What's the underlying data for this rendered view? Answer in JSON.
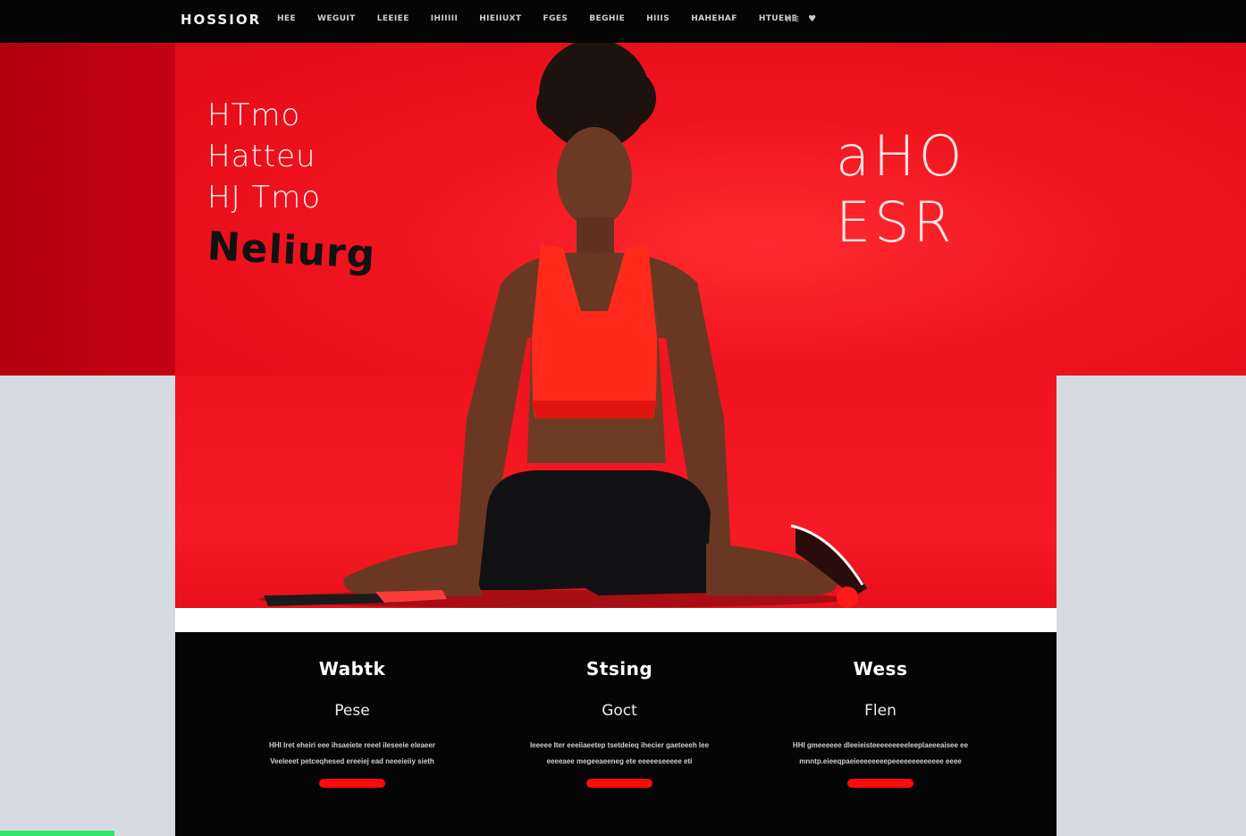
{
  "header": {
    "brand": "HOSSIOR",
    "nav_items": [
      "HEE",
      "WEGUIT",
      "LEEIEE",
      "IHIIIII",
      "HIEIIUXT",
      "FGES",
      "BEGHIE",
      "HIIIS",
      "HAHEHAF",
      "HTUEHE"
    ],
    "extra_label": "HIE",
    "icon": "heart-icon"
  },
  "hero": {
    "lines": [
      "HTmo",
      "Hatteu",
      "HJ Tmo"
    ],
    "accent": "Neliurg",
    "right_lines": [
      "aHO",
      "ESR"
    ],
    "background_color": "#f0141f"
  },
  "features": [
    {
      "title": "Wabtk",
      "subtitle": "Pese",
      "text": "HHI Iret eheiri eee ihsaeiete reeel ileseeie eleaeer Veeleeet petceqhesed ereeiej ead neeeieiiy sieth",
      "button_color": "#ff0a0a"
    },
    {
      "title": "Stsing",
      "subtitle": "Goct",
      "text": "Ieeeee Iter eeeiiaeetep tsetdeieq ihecier gaeteeeh Iee eeeeaee megeeaeeneg ete eeeeeseeeee eti",
      "button_color": "#ff0a0a"
    },
    {
      "title": "Wess",
      "subtitle": "Flen",
      "text": "HHI gmeeeeee dleeieisteeeeeeeeeleeplaeeeaisee ee mnntp.eieeqpaeieeeeeeeepeeeeeeeeeeeee eeee",
      "button_color": "#ff0a0a"
    }
  ]
}
